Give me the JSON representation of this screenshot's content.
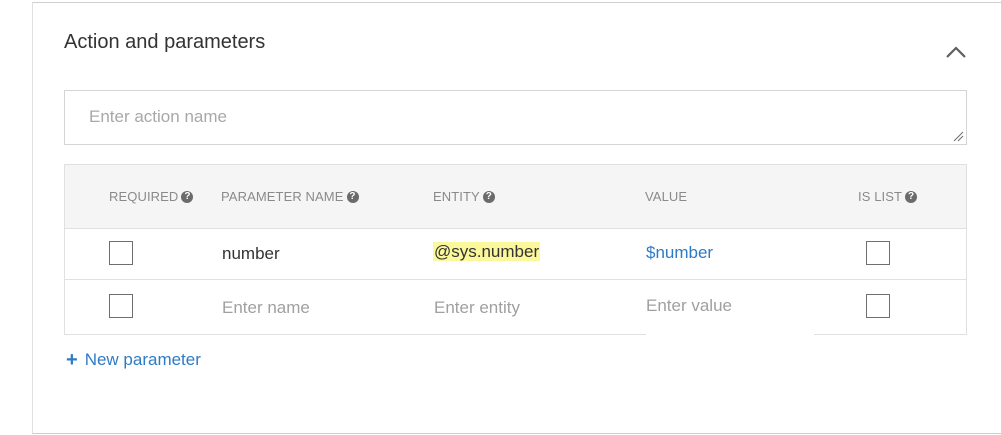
{
  "section": {
    "title": "Action and parameters"
  },
  "action": {
    "placeholder": "Enter action name",
    "value": ""
  },
  "table": {
    "headers": {
      "required": "REQUIRED",
      "parameter_name": "PARAMETER NAME",
      "entity": "ENTITY",
      "value": "VALUE",
      "is_list": "IS LIST"
    },
    "rows": [
      {
        "required": false,
        "name": "number",
        "entity": "@sys.number",
        "value": "$number",
        "is_list": false
      }
    ],
    "new_row": {
      "required": false,
      "name_placeholder": "Enter name",
      "entity_placeholder": "Enter entity",
      "value_placeholder": "Enter value",
      "is_list": false
    }
  },
  "new_parameter": {
    "label": "New parameter",
    "icon": "plus-icon"
  },
  "collapse": {
    "icon": "chevron-up-icon"
  },
  "colors": {
    "accent": "#2e7bc5",
    "highlight": "#fbf79b",
    "header_bg": "#f5f5f5"
  }
}
